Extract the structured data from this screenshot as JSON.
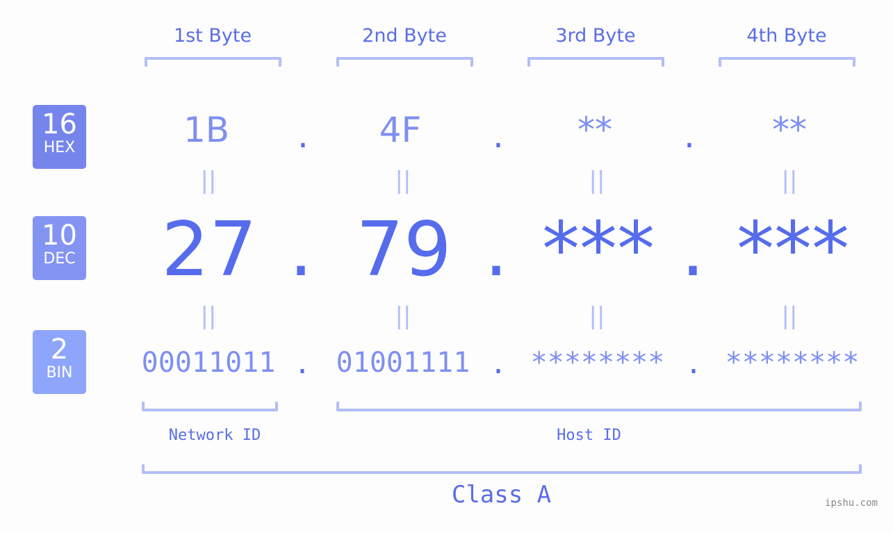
{
  "bytes": [
    {
      "title": "1st Byte",
      "hex": "1B",
      "dec": "27",
      "bin": "00011011"
    },
    {
      "title": "2nd Byte",
      "hex": "4F",
      "dec": "79",
      "bin": "01001111"
    },
    {
      "title": "3rd Byte",
      "hex": "**",
      "dec": "***",
      "bin": "********"
    },
    {
      "title": "4th Byte",
      "hex": "**",
      "dec": "***",
      "bin": "********"
    }
  ],
  "separator": ".",
  "equals": "||",
  "badges": {
    "hex": {
      "num": "16",
      "label": "HEX",
      "color": "#7685ec"
    },
    "dec": {
      "num": "10",
      "label": "DEC",
      "color": "#8494f3"
    },
    "bin": {
      "num": "2",
      "label": "BIN",
      "color": "#8ea5fb"
    }
  },
  "labels": {
    "network_id": "Network ID",
    "host_id": "Host ID",
    "class": "Class A"
  },
  "watermark": "ipshu.com",
  "colors": {
    "accent": "#566ced",
    "light_accent": "#7f8ff0",
    "bracket": "#b3bdf8",
    "background": "#fcfdfc"
  }
}
